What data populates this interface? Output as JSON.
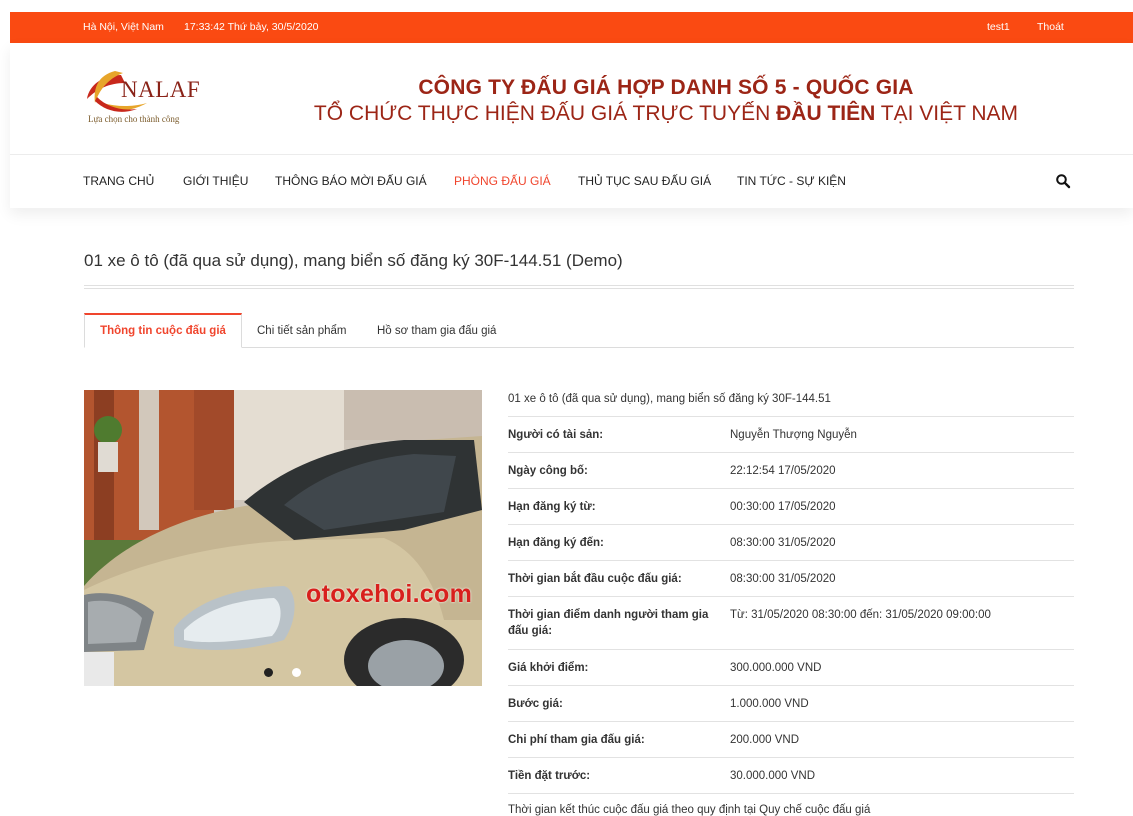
{
  "topbar": {
    "location": "Hà Nội, Việt Nam",
    "datetime": "17:33:42 Thứ bảy, 30/5/2020",
    "username": "test1",
    "logout": "Thoát"
  },
  "logo": {
    "brand": "NALAF",
    "slogan": "Lựa chọn cho thành công"
  },
  "company": {
    "name": "CÔNG TY ĐẤU GIÁ HỢP DANH SỐ 5 - QUỐC GIA",
    "tagline_before": "TỔ CHỨC THỰC HIỆN ĐẤU GIÁ TRỰC TUYẾN",
    "tagline_bold": "ĐẦU TIÊN",
    "tagline_after": "TẠI VIỆT NAM"
  },
  "nav": {
    "items": [
      "TRANG CHỦ",
      "GIỚI THIỆU",
      "THÔNG BÁO MỜI ĐẤU GIÁ",
      "PHÒNG ĐẤU GIÁ",
      "THỦ TỤC SAU ĐẤU GIÁ",
      "TIN TỨC - SỰ KIỆN"
    ],
    "active_index": 3,
    "search_icon": "search-icon"
  },
  "page": {
    "title": "01 xe ô tô (đã qua sử dụng), mang biển số đăng ký 30F-144.51 (Demo)"
  },
  "tabs": [
    "Thông tin cuộc đấu giá",
    "Chi tiết sản phẩm",
    "Hồ sơ tham gia đấu giá"
  ],
  "gallery": {
    "watermark": "otoxehoi.com",
    "slide_count": 2,
    "active_slide": 1
  },
  "details": {
    "heading": "01 xe ô tô (đã qua sử dụng), mang biển số đăng ký 30F-144.51",
    "rows": [
      {
        "label": "Người có tài sản:",
        "value": "Nguyễn Thượng Nguyễn"
      },
      {
        "label": "Ngày công bố:",
        "value": "22:12:54 17/05/2020"
      },
      {
        "label": "Hạn đăng ký từ:",
        "value": "00:30:00 17/05/2020"
      },
      {
        "label": "Hạn đăng ký đến:",
        "value": "08:30:00 31/05/2020"
      },
      {
        "label": "Thời gian bắt đầu cuộc đấu giá:",
        "value": "08:30:00 31/05/2020"
      },
      {
        "label": "Thời gian điểm danh người tham gia đấu giá:",
        "value": "Từ: 31/05/2020 08:30:00 đến: 31/05/2020 09:00:00"
      },
      {
        "label": "Giá khởi điểm:",
        "value": "300.000.000 VND"
      },
      {
        "label": "Bước giá:",
        "value": "1.000.000 VND"
      },
      {
        "label": "Chi phí tham gia đấu giá:",
        "value": "200.000 VND"
      },
      {
        "label": "Tiền đặt trước:",
        "value": "30.000.000 VND"
      }
    ],
    "footer": "Thời gian kết thúc cuộc đấu giá theo quy định tại Quy chế cuộc đấu giá"
  },
  "colors": {
    "topbar": "#fa4a12",
    "company_text": "#9c2516",
    "accent": "#f0452d"
  }
}
